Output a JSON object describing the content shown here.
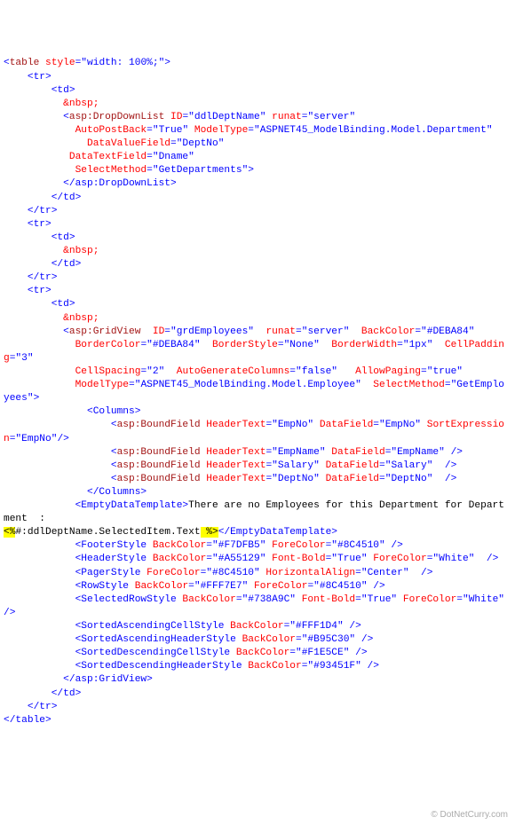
{
  "footer": "© DotNetCurry.com",
  "code": {
    "table_open_1": "<",
    "table_open_name": "table",
    "table_style_attr": " style",
    "table_style_val": "=\"width: 100%;\">",
    "tr_open": "    <tr>",
    "td_open": "        <td>",
    "nbsp": "          &nbsp;",
    "ddl_open_lt": "          <",
    "ddl_open_name": "asp:DropDownList",
    "ddl_id_attr": " ID",
    "ddl_id_val": "=\"ddlDeptName\"",
    "ddl_runat_attr": " runat",
    "ddl_runat_val": "=\"server\"",
    "ddl_autopb_attr": "            AutoPostBack",
    "ddl_autopb_val": "=\"True\"",
    "ddl_modeltype_attr": " ModelType",
    "ddl_modeltype_val": "=\"ASPNET45_ModelBinding.Model.Department\"",
    "ddl_dvf_attr": "              DataValueField",
    "ddl_dvf_val": "=\"DeptNo\"",
    "ddl_dtf_attr": "           DataTextField",
    "ddl_dtf_val": "=\"Dname\"",
    "ddl_selmethod_attr": "            SelectMethod",
    "ddl_selmethod_val": "=\"GetDepartments\">",
    "ddl_close": "          </asp:DropDownList>",
    "td_close": "        </td>",
    "tr_close": "    </tr>",
    "grid_open_lt": "          <",
    "grid_open_name": "asp:GridView",
    "gv_id_attr": "  ID",
    "gv_id_val": "=\"grdEmployees\"",
    "gv_runat_attr": "  runat",
    "gv_runat_val": "=\"server\"",
    "gv_backcolor_attr": "  BackColor",
    "gv_backcolor_val": "=\"#DEBA84\"",
    "gv_bordercol_attr": "            BorderColor",
    "gv_bordercol_val": "=\"#DEBA84\"",
    "gv_borderstyle_attr": "  BorderStyle",
    "gv_borderstyle_val": "=\"None\"",
    "gv_borderwidth_attr": "  BorderWidth",
    "gv_borderwidth_val": "=\"1px\"",
    "gv_cellpadding_attr": "  CellPadding",
    "gv_cellpadding_val": "=\"3\"",
    "gv_cellspacing_attr": "            CellSpacing",
    "gv_cellspacing_val": "=\"2\"",
    "gv_autogen_attr": "  AutoGenerateColumns",
    "gv_autogen_val": "=\"false\"",
    "gv_allowpaging_attr": "   AllowPaging",
    "gv_allowpaging_val": "=\"true\"",
    "gv_modeltype_attr": "            ModelType",
    "gv_modeltype_val": "=\"ASPNET45_ModelBinding.Model.Employee\"",
    "gv_selmethod_attr": "  SelectMethod",
    "gv_selmethod_val": "=\"GetEmployees\">",
    "columns_open": "              <Columns>",
    "columns_close": "              </Columns>",
    "bf_lt": "                  <",
    "bf_name": "asp:BoundField",
    "bf_headertext_attr": " HeaderText",
    "bf_datafield_attr": " DataField",
    "bf_sortexpr_attr": " SortExpression",
    "bf_empno": "=\"EmpNo\"",
    "bf_empname": "=\"EmpName\"",
    "bf_salary": "=\"Salary\"",
    "bf_deptno": "=\"DeptNo\"",
    "bf_close": "/>",
    "bf_close_sp": " />",
    "bf_close_sp2": "  />",
    "edt_open": "            <EmptyDataTemplate>",
    "edt_text": "There are no Employees for this Department for Department  : ",
    "edt_hl_open": "<%",
    "edt_mid": "#:ddlDeptName.SelectedItem.Text",
    "edt_hl_close": " %>",
    "edt_close": "</EmptyDataTemplate>",
    "fs_open": "            <FooterStyle",
    "fs_backcolor_attr": " BackColor",
    "fs_backcolor_val": "=\"#F7DFB5\"",
    "fs_forecolor_attr": " ForeColor",
    "fs_forecolor_val": "=\"#8C4510\"",
    "close_sp": " />",
    "hs_open": "            <HeaderStyle",
    "hs_backcolor_val": "=\"#A55129\"",
    "hs_fontbold_attr": " Font-Bold",
    "hs_fontbold_val": "=\"True\"",
    "hs_forecolor_val": "=\"White\"",
    "hs_close": "  />",
    "ps_open": "            <PagerStyle",
    "ps_forecolor_val": "=\"#8C4510\"",
    "ps_halign_attr": " HorizontalAlign",
    "ps_halign_val": "=\"Center\"",
    "rs_open": "            <RowStyle",
    "rs_backcolor_val": "=\"#FFF7E7\"",
    "rs_forecolor_val": "=\"#8C4510\"",
    "srs_open": "            <SelectedRowStyle",
    "srs_backcolor_val": "=\"#738A9C\"",
    "srs_forecolor_val": "=\"White\"",
    "sacs_open": "            <SortedAscendingCellStyle",
    "sacs_backcolor_val": "=\"#FFF1D4\"",
    "sahs_open": "            <SortedAscendingHeaderStyle",
    "sahs_backcolor_val": "=\"#B95C30\"",
    "sdcs_open": "            <SortedDescendingCellStyle",
    "sdcs_backcolor_val": "=\"#F1E5CE\"",
    "sdhs_open": "            <SortedDescendingHeaderStyle",
    "sdhs_backcolor_val": "=\"#93451F\"",
    "grid_close": "          </asp:GridView>",
    "table_close": "</table>"
  }
}
